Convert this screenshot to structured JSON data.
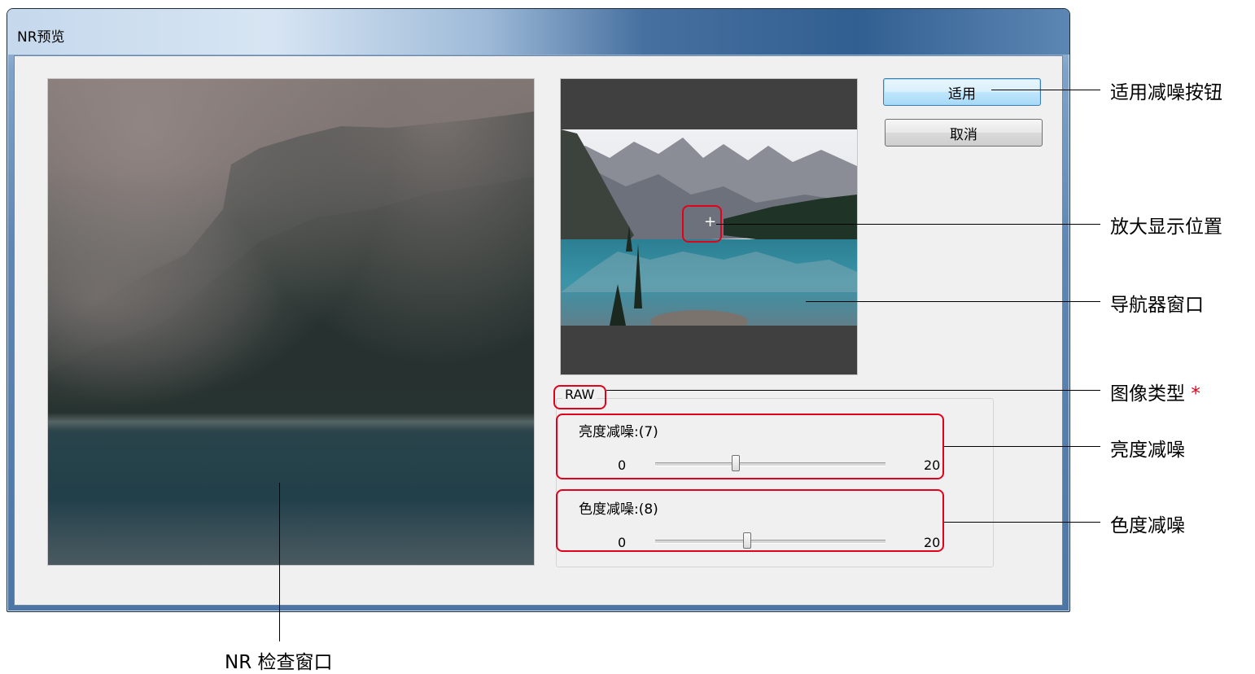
{
  "window": {
    "title": "NR预览"
  },
  "buttons": {
    "apply_label": "适用",
    "cancel_label": "取消"
  },
  "image_type": "RAW",
  "luminance_nr": {
    "label": "亮度减噪:(7)",
    "min": "0",
    "max": "20",
    "value": 7,
    "range": [
      0,
      20
    ]
  },
  "chroma_nr": {
    "label": "色度减噪:(8)",
    "min": "0",
    "max": "20",
    "value": 8,
    "range": [
      0,
      20
    ]
  },
  "navigator": {
    "crosshair_icon": "+"
  },
  "callouts": {
    "apply_button": "适用减噪按钮",
    "zoom_position": "放大显示位置",
    "navigator_window": "导航器窗口",
    "image_type": "图像类型",
    "image_type_mark": "*",
    "luminance_nr": "亮度减噪",
    "chroma_nr": "色度减噪",
    "nr_check_window": "NR 检查窗口"
  },
  "colors": {
    "highlight": "#e2001a",
    "apply_button_border": "#3c7fb1"
  }
}
